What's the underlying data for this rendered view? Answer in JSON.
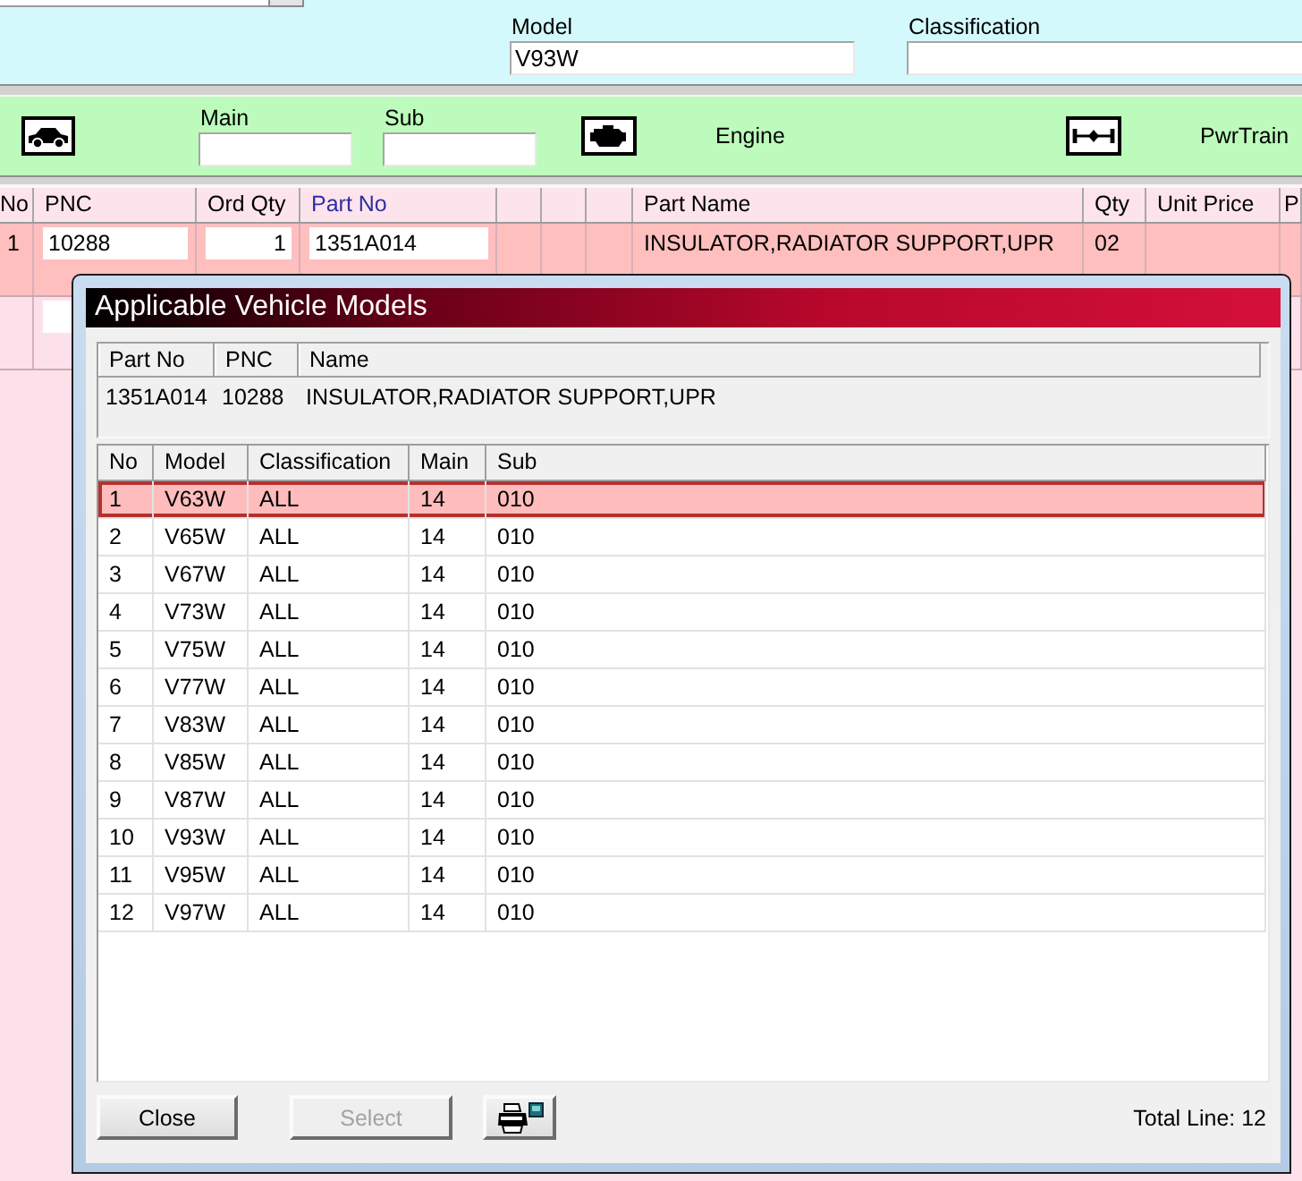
{
  "filter_bar": {
    "fields": [
      {
        "label": "Model",
        "value": "V93W"
      },
      {
        "label": "Classification"
      }
    ]
  },
  "group_bar": {
    "fields": [
      {
        "label": "Main"
      },
      {
        "label": "Sub"
      }
    ],
    "categories": [
      {
        "label": "Engine"
      },
      {
        "label": "PwrTrain"
      }
    ]
  },
  "parts_table": {
    "columns": [
      {
        "kind": "label",
        "label": "No",
        "highlighted": false
      },
      {
        "kind": "label",
        "label": "PNC",
        "highlighted": false
      },
      {
        "kind": "label",
        "label": "Ord Qty",
        "highlighted": false
      },
      {
        "kind": "label",
        "label": "Part No",
        "highlighted": true
      },
      {
        "kind": "blank"
      },
      {
        "kind": "blank"
      },
      {
        "kind": "blank"
      },
      {
        "kind": "label",
        "label": "Part Name",
        "highlighted": false
      },
      {
        "kind": "label",
        "label": "Qty",
        "highlighted": false
      },
      {
        "kind": "label",
        "label": "Unit Price",
        "highlighted": false
      },
      {
        "kind": "label",
        "label": "P",
        "highlighted": false
      }
    ],
    "rows": [
      {
        "selected": true,
        "cells": [
          {
            "kind": "index",
            "text": "1"
          },
          {
            "kind": "field",
            "text": "10288"
          },
          {
            "kind": "number_field",
            "text": "1"
          },
          {
            "kind": "field",
            "text": "1351A014"
          },
          {
            "kind": "empty"
          },
          {
            "kind": "empty"
          },
          {
            "kind": "empty"
          },
          {
            "kind": "text",
            "text": "INSULATOR,RADIATOR SUPPORT,UPR"
          },
          {
            "kind": "text",
            "text": "02"
          },
          {
            "kind": "empty"
          },
          {
            "kind": "empty"
          }
        ]
      },
      {
        "selected": false,
        "cells": [
          {
            "kind": "empty"
          },
          {
            "kind": "field"
          }
        ]
      }
    ]
  },
  "dialog": {
    "title": "Applicable Vehicle Models",
    "part_info": {
      "columns": [
        "Part No",
        "PNC",
        "Name"
      ],
      "values": [
        "1351A014",
        "10288",
        "INSULATOR,RADIATOR SUPPORT,UPR"
      ]
    },
    "models_table": {
      "columns": [
        "No",
        "Model",
        "Classification",
        "Main",
        "Sub"
      ],
      "rows": [
        {
          "selected": true,
          "cells": [
            "1",
            "V63W",
            "ALL",
            "14",
            "010"
          ]
        },
        {
          "selected": false,
          "cells": [
            "2",
            "V65W",
            "ALL",
            "14",
            "010"
          ]
        },
        {
          "selected": false,
          "cells": [
            "3",
            "V67W",
            "ALL",
            "14",
            "010"
          ]
        },
        {
          "selected": false,
          "cells": [
            "4",
            "V73W",
            "ALL",
            "14",
            "010"
          ]
        },
        {
          "selected": false,
          "cells": [
            "5",
            "V75W",
            "ALL",
            "14",
            "010"
          ]
        },
        {
          "selected": false,
          "cells": [
            "6",
            "V77W",
            "ALL",
            "14",
            "010"
          ]
        },
        {
          "selected": false,
          "cells": [
            "7",
            "V83W",
            "ALL",
            "14",
            "010"
          ]
        },
        {
          "selected": false,
          "cells": [
            "8",
            "V85W",
            "ALL",
            "14",
            "010"
          ]
        },
        {
          "selected": false,
          "cells": [
            "9",
            "V87W",
            "ALL",
            "14",
            "010"
          ]
        },
        {
          "selected": false,
          "cells": [
            "10",
            "V93W",
            "ALL",
            "14",
            "010"
          ]
        },
        {
          "selected": false,
          "cells": [
            "11",
            "V95W",
            "ALL",
            "14",
            "010"
          ]
        },
        {
          "selected": false,
          "cells": [
            "12",
            "V97W",
            "ALL",
            "14",
            "010"
          ]
        }
      ]
    },
    "buttons": [
      {
        "kind": "text",
        "label": "Close",
        "disabled": false
      },
      {
        "kind": "text",
        "label": "Select",
        "disabled": true
      },
      {
        "kind": "print",
        "disabled": false
      }
    ],
    "total_line": "Total Line: 12"
  }
}
